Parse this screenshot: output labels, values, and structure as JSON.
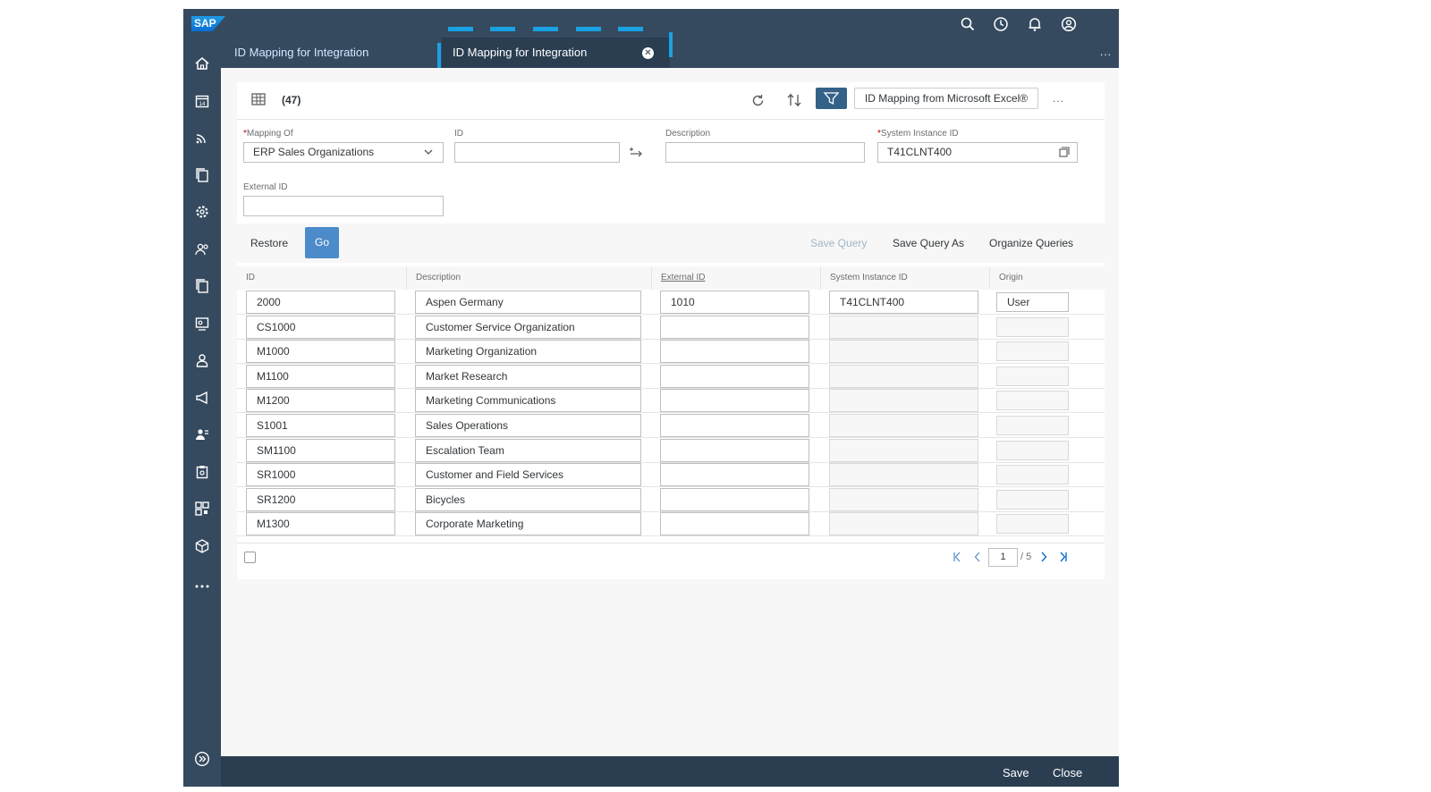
{
  "shell": {
    "logo": "SAP"
  },
  "tabs": [
    {
      "label": "ID Mapping for Integration"
    },
    {
      "label": "ID Mapping for Integration",
      "close": "✕"
    }
  ],
  "toolbar": {
    "count": "(47)",
    "excel_button": "ID Mapping from Microsoft Excel®",
    "more": "..."
  },
  "filters": {
    "mapping_of": {
      "label": "Mapping Of",
      "value": "ERP Sales Organizations",
      "required": "*"
    },
    "id": {
      "label": "ID",
      "value": ""
    },
    "description": {
      "label": "Description",
      "value": ""
    },
    "system_instance": {
      "label": "System Instance ID",
      "value": "T41CLNT400",
      "required": "*"
    },
    "external_id": {
      "label": "External ID",
      "value": ""
    }
  },
  "filterbar": {
    "restore": "Restore",
    "go": "Go",
    "save_query": "Save Query",
    "save_query_as": "Save Query As",
    "organize_queries": "Organize Queries"
  },
  "table": {
    "columns": [
      "ID",
      "Description",
      "External ID",
      "System Instance ID",
      "Origin"
    ],
    "rows": [
      {
        "id": "2000",
        "description": "Aspen Germany",
        "external_id": "1010",
        "system": "T41CLNT400",
        "origin": "User"
      },
      {
        "id": "CS1000",
        "description": "Customer Service Organization",
        "external_id": "",
        "system": "",
        "origin": ""
      },
      {
        "id": "M1000",
        "description": "Marketing Organization",
        "external_id": "",
        "system": "",
        "origin": ""
      },
      {
        "id": "M1100",
        "description": "Market Research",
        "external_id": "",
        "system": "",
        "origin": ""
      },
      {
        "id": "M1200",
        "description": "Marketing Communications",
        "external_id": "",
        "system": "",
        "origin": ""
      },
      {
        "id": "S1001",
        "description": "Sales Operations",
        "external_id": "",
        "system": "",
        "origin": ""
      },
      {
        "id": "SM1100",
        "description": "Escalation Team",
        "external_id": "",
        "system": "",
        "origin": ""
      },
      {
        "id": "SR1000",
        "description": "Customer and Field Services",
        "external_id": "",
        "system": "",
        "origin": ""
      },
      {
        "id": "SR1200",
        "description": "Bicycles",
        "external_id": "",
        "system": "",
        "origin": ""
      },
      {
        "id": "M1300",
        "description": "Corporate Marketing",
        "external_id": "",
        "system": "",
        "origin": ""
      }
    ]
  },
  "pager": {
    "page": "1",
    "total": "/ 5"
  },
  "footer": {
    "save": "Save",
    "close": "Close"
  },
  "colors": {
    "shell": "#354a5f",
    "accent": "#0a6ed1",
    "highlight": "#1aa1e3"
  }
}
